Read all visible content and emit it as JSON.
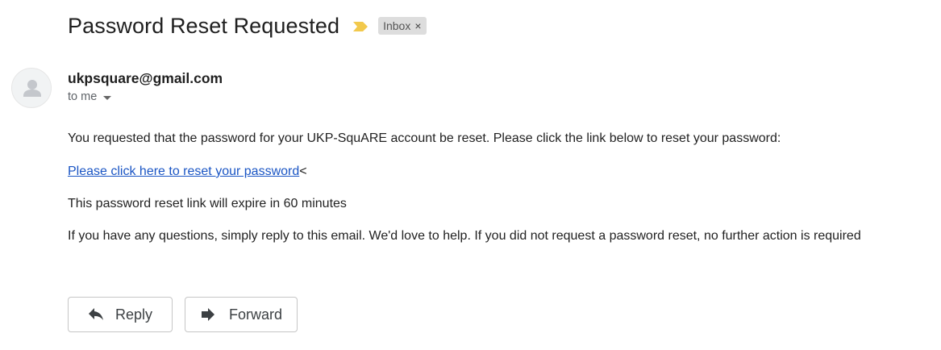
{
  "email": {
    "subject": "Password Reset Requested",
    "importance_icon": "importance-marker-icon",
    "label": {
      "text": "Inbox",
      "close": "×"
    },
    "sender": "ukpsquare@gmail.com",
    "recipient_text": "to me",
    "body": {
      "line1": "You requested that the password for your UKP-SquARE account be reset. Please click the link below to reset your password:",
      "link_text": "Please click here to reset your password",
      "link_suffix": "<",
      "line3": "This password reset link will expire in 60 minutes",
      "line4": "If you have any questions, simply reply to this email. We'd love to help. If you did not request a password reset, no further action is required"
    }
  },
  "actions": {
    "reply_label": "Reply",
    "forward_label": "Forward"
  },
  "colors": {
    "importance": "#f2c94c",
    "link": "#1a55c4",
    "chip_bg": "#dddddd"
  }
}
